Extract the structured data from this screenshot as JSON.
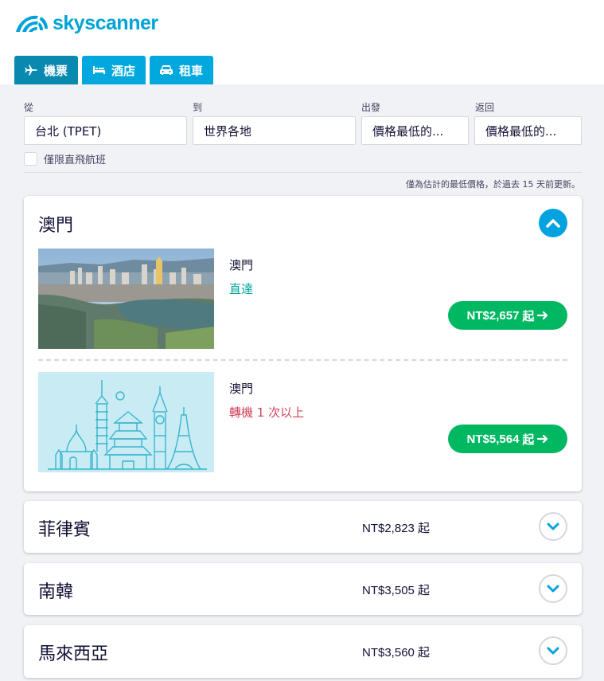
{
  "brand": {
    "name": "skyscanner",
    "color": "#00a3d6"
  },
  "tabs": [
    {
      "label": "機票",
      "icon": "plane-icon",
      "active": true
    },
    {
      "label": "酒店",
      "icon": "bed-icon",
      "active": false
    },
    {
      "label": "租車",
      "icon": "car-icon",
      "active": false
    }
  ],
  "search": {
    "from_label": "從",
    "from_value": "台北 (TPET)",
    "to_label": "到",
    "to_value": "世界各地",
    "depart_label": "出發",
    "depart_value": "價格最低的...",
    "return_label": "返回",
    "return_value": "價格最低的...",
    "direct_only_label": "僅限直飛航班"
  },
  "disclaimer": "僅為估計的最低價格，於過去 15 天前更新。",
  "expanded": {
    "title": "澳門",
    "options": [
      {
        "city": "澳門",
        "stops": "直達",
        "stops_color": "#00a698",
        "price": "NT$2,657",
        "suffix": "起"
      },
      {
        "city": "澳門",
        "stops": "轉機 1 次以上",
        "stops_color": "#d1435b",
        "price": "NT$5,564",
        "suffix": "起"
      }
    ]
  },
  "destinations": [
    {
      "name": "菲律賓",
      "price": "NT$2,823 起"
    },
    {
      "name": "南韓",
      "price": "NT$3,505 起"
    },
    {
      "name": "馬來西亞",
      "price": "NT$3,560 起"
    }
  ],
  "colors": {
    "accent": "#00a3e0",
    "cta": "#00b862",
    "tab_active": "#0789b0",
    "tab": "#00a8dd"
  }
}
